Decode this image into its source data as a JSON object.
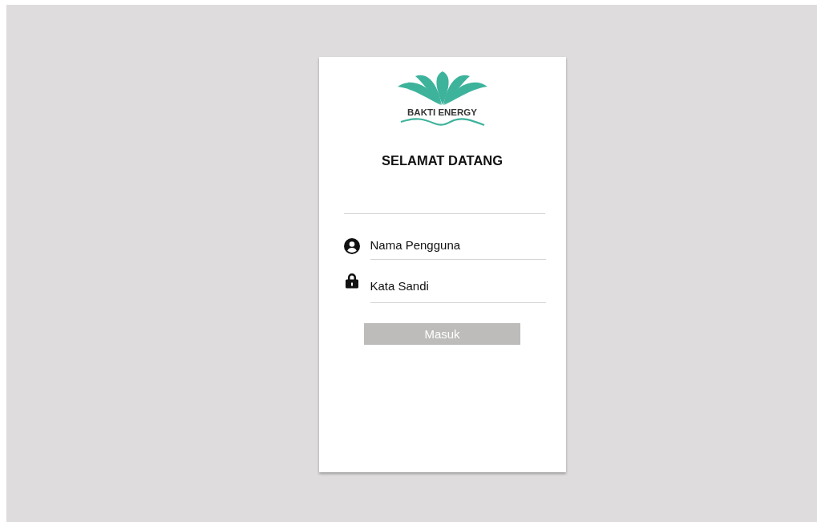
{
  "logo": {
    "text": "BAKTI ENERGY"
  },
  "title": "SELAMAT DATANG",
  "fields": [
    {
      "kind": "user",
      "placeholder": "Nama Pengguna"
    },
    {
      "kind": "password",
      "placeholder": "Kata Sandi"
    }
  ],
  "button": {
    "label": "Masuk",
    "disabled": true
  }
}
